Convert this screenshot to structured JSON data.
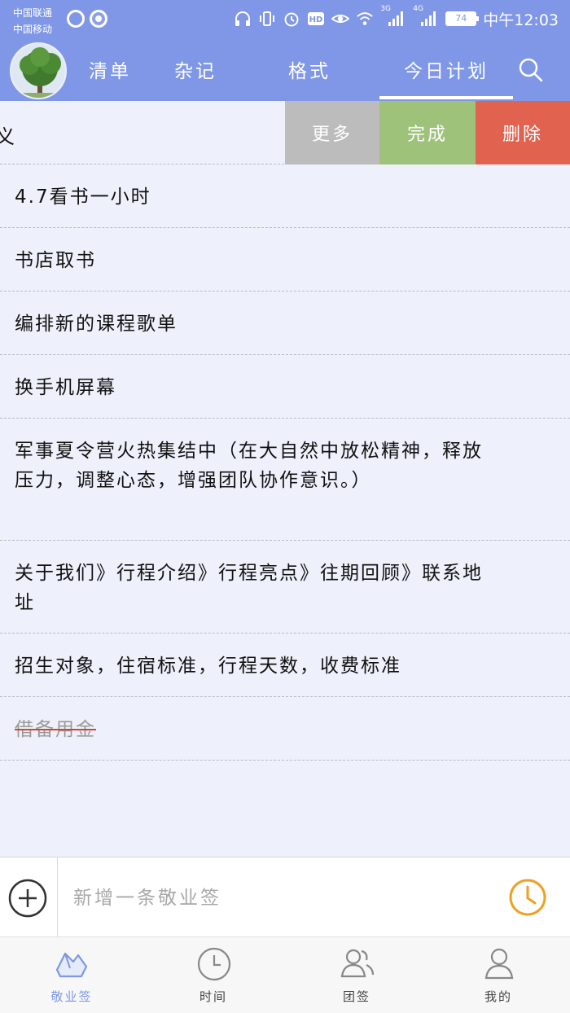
{
  "status_bar": {
    "carrier_1": "中国联通",
    "carrier_2": "中国移动",
    "network_3g": "3G",
    "network_4g": "4G",
    "battery": "74",
    "time": "中午12:03"
  },
  "header": {
    "tabs": [
      {
        "label": "清单"
      },
      {
        "label": "杂记"
      },
      {
        "label": "格式"
      },
      {
        "label": "今日计划",
        "active": true
      }
    ]
  },
  "swipe_row": {
    "partial_text": "义",
    "actions": {
      "more": "更多",
      "done": "完成",
      "delete": "删除"
    }
  },
  "items": [
    {
      "text": "4.7看书一小时",
      "done": false
    },
    {
      "text": "书店取书",
      "done": false
    },
    {
      "text": "编排新的课程歌单",
      "done": false
    },
    {
      "text": "换手机屏幕",
      "done": false
    },
    {
      "text": "军事夏令营火热集结中（在大自然中放松精神，释放压力，调整心态，增强团队协作意识。）",
      "done": false
    },
    {
      "text": "关于我们》行程介绍》行程亮点》往期回顾》联系地址",
      "done": false
    },
    {
      "text": "招生对象，住宿标准，行程天数，收费标准",
      "done": false
    },
    {
      "text": "借备用金",
      "done": true
    }
  ],
  "input_bar": {
    "placeholder": "新增一条敬业签"
  },
  "bottom_nav": {
    "items": [
      {
        "label": "敬业签",
        "active": true
      },
      {
        "label": "时间"
      },
      {
        "label": "团签"
      },
      {
        "label": "我的"
      }
    ]
  },
  "colors": {
    "primary": "#7f97e6",
    "more": "#bcbcbc",
    "done": "#9ec27a",
    "delete": "#e1624f",
    "alarm": "#f0a020",
    "strike": "#d8452f"
  }
}
